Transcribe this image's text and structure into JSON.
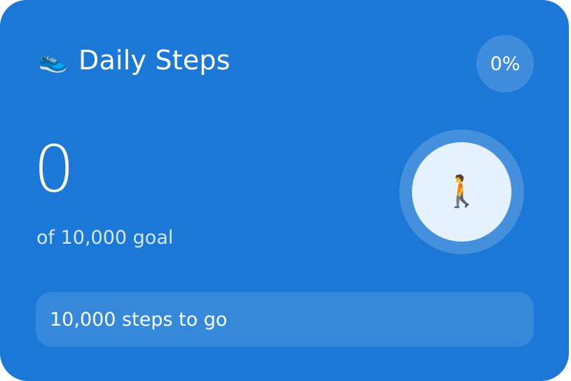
{
  "widget": {
    "title": "Daily Steps",
    "title_icon": "shoe-icon",
    "percent_label": "0%",
    "progress_fraction": 0,
    "step_count": "0",
    "goal_label": "of 10,000 goal",
    "progress_icon": "person-walking-icon",
    "remaining_label": "10,000 steps to go"
  },
  "colors": {
    "card_background": "#1b78d6",
    "ring_inner": "#e5f2fd",
    "text": "#ffffff"
  }
}
